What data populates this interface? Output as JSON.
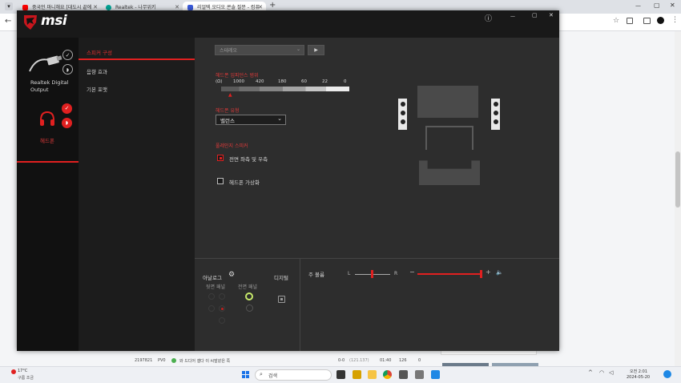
{
  "browser": {
    "tabs": [
      {
        "label": "중국언 마니해요 [대도시 끝에",
        "favicon_color": "#ff0000"
      },
      {
        "label": "Realtek - 나무위키",
        "favicon_color": "#00a495"
      },
      {
        "label": "리얼텍 오디오 콘솔 질문 - 컴퓨",
        "favicon_color": "#3b5bdb"
      }
    ],
    "new_tab": "+",
    "window_controls": {
      "minimize": "—",
      "maximize": "▢",
      "close": "✕"
    },
    "nav": {
      "back": "←",
      "forward": "→",
      "reload": "↻"
    },
    "toolbar_icons": [
      "star-icon",
      "extension-icon",
      "sidepanel-icon",
      "profile-icon",
      "menu-icon"
    ]
  },
  "app": {
    "logo": "msi",
    "info_icon": "ⓘ",
    "window_controls": {
      "minimize": "—",
      "maximize": "▢",
      "close": "✕"
    },
    "devices": [
      {
        "label_line1": "Realtek Digital",
        "label_line2": "Output"
      },
      {
        "label": "헤드폰"
      }
    ],
    "nav": [
      {
        "label": "스피커 구성",
        "active": true
      },
      {
        "label": "음향 효과",
        "active": false
      },
      {
        "label": "기본 포맷",
        "active": false
      }
    ],
    "config_select": "스테레오",
    "play_button": "▶",
    "headphone_impedance": {
      "title": "헤드폰 임피던스 범위",
      "scale": [
        "(Ω)",
        "1000",
        "420",
        "180",
        "60",
        "22",
        "0"
      ],
      "marker": "▲"
    },
    "headphone_type": {
      "title": "헤드폰 유형",
      "value": "밸런스"
    },
    "full_range": {
      "title": "풀레인지 스피커",
      "options": [
        {
          "label": "전면 좌측 및 우측",
          "checked": true
        },
        {
          "label": "헤드폰 가상화",
          "checked": false
        }
      ]
    },
    "bottom": {
      "analog_label": "아날로그",
      "back_panel": "뒷면 패널",
      "front_panel": "전면 패널",
      "digital_label": "디지털",
      "main_volume": "주 볼륨",
      "balance_left": "L",
      "balance_right": "R",
      "vol_minus": "−",
      "vol_plus": "+",
      "volume_fraction": 0.97,
      "balance_fraction": 0.5
    }
  },
  "page_behind": {
    "row": {
      "num": "2197821",
      "tag": "PV0",
      "title": "와 드디어 갤다 이 씨발같은 쪽",
      "meta1": "0-0",
      "meta2": "(121.137)",
      "time": "01:40",
      "views": "126",
      "votes": "0"
    }
  },
  "taskbar": {
    "weather_temp": "17°C",
    "weather_desc": "구름 조금",
    "search_placeholder": "검색",
    "time": "오전 2:01",
    "date": "2024-05-20"
  }
}
